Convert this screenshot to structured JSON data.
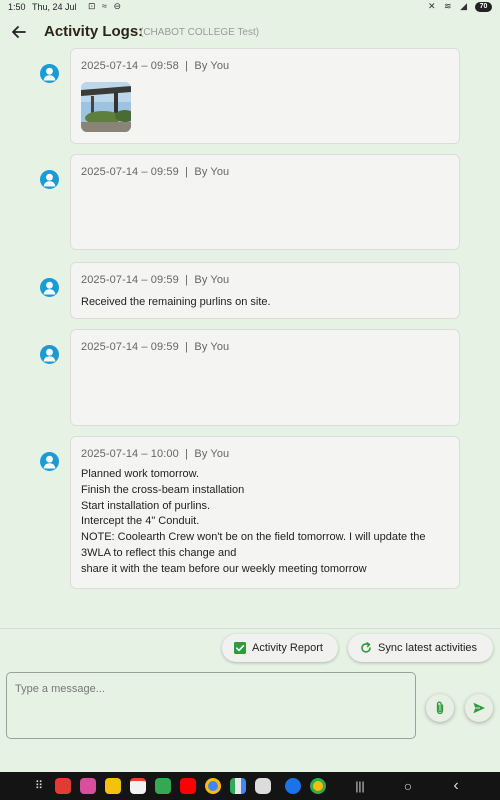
{
  "status": {
    "time": "1:50",
    "date": "Thu, 24 Jul",
    "battery": "70"
  },
  "header": {
    "title": "Activity Logs:",
    "subtitle": "(CHABOT COLLEGE Test)"
  },
  "entries": [
    {
      "timestamp": "2025-07-14 – 09:58",
      "author": "By You",
      "text": "",
      "has_image": true
    },
    {
      "timestamp": "2025-07-14 – 09:59",
      "author": "By You",
      "text": "",
      "has_image": false
    },
    {
      "timestamp": "2025-07-14 – 09:59",
      "author": "By You",
      "text": "Received the remaining purlins on site.",
      "has_image": false
    },
    {
      "timestamp": "2025-07-14 – 09:59",
      "author": "By You",
      "text": "",
      "has_image": false
    },
    {
      "timestamp": "2025-07-14 – 10:00",
      "author": "By You",
      "text": "Planned work tomorrow.\nFinish the cross-beam installation\nStart installation of purlins.\nIntercept the 4\" Conduit.\nNOTE: Coolearth Crew won't be on the field tomorrow. I will update the\n3WLA to reflect this change and\nshare it with the team before our weekly meeting tomorrow",
      "has_image": false
    }
  ],
  "actions": {
    "activity_report": "Activity Report",
    "sync": "Sync latest activities"
  },
  "composer": {
    "placeholder": "Type a message..."
  },
  "colors": {
    "accent_green": "#2e9c3c",
    "avatar_blue": "#1b9ad8",
    "background": "#e6f3e4"
  }
}
